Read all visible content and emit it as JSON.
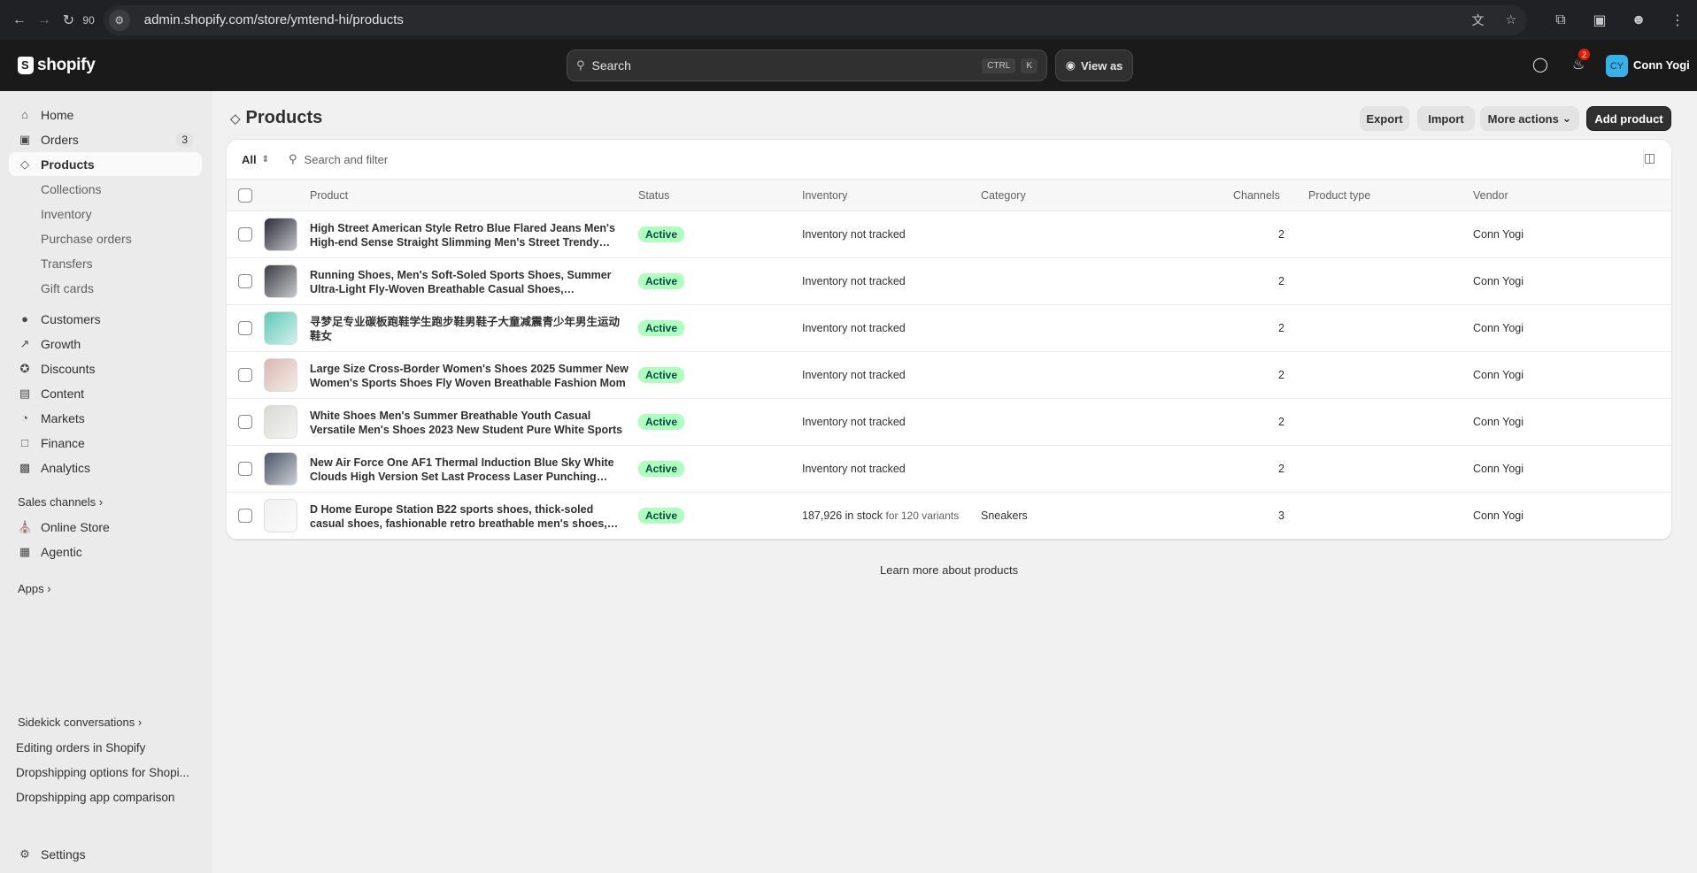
{
  "browser": {
    "zoom": "90",
    "url": "admin.shopify.com/store/ymtend-hi/products"
  },
  "topbar": {
    "logo_text": "shopify",
    "search_placeholder": "Search",
    "shortcut_ctrl": "CTRL",
    "shortcut_k": "K",
    "view_as": "View as",
    "notifications_count": "2",
    "avatar_initials": "CY",
    "user_name": "Conn Yogi"
  },
  "sidebar": {
    "items": [
      {
        "label": "Home",
        "icon": "home-icon"
      },
      {
        "label": "Orders",
        "icon": "orders-icon",
        "count": "3"
      },
      {
        "label": "Products",
        "icon": "tag-icon",
        "active": true
      },
      {
        "label": "Collections",
        "sub": true
      },
      {
        "label": "Inventory",
        "sub": true
      },
      {
        "label": "Purchase orders",
        "sub": true
      },
      {
        "label": "Transfers",
        "sub": true
      },
      {
        "label": "Gift cards",
        "sub": true
      },
      {
        "label": "Customers",
        "icon": "person-icon"
      },
      {
        "label": "Growth",
        "icon": "growth-icon"
      },
      {
        "label": "Discounts",
        "icon": "discount-icon"
      },
      {
        "label": "Content",
        "icon": "content-icon"
      },
      {
        "label": "Markets",
        "icon": "globe-icon"
      },
      {
        "label": "Finance",
        "icon": "bank-icon"
      },
      {
        "label": "Analytics",
        "icon": "chart-icon"
      }
    ],
    "sales_channels_label": "Sales channels",
    "channels": [
      {
        "label": "Online Store",
        "icon": "store-icon"
      },
      {
        "label": "Agentic",
        "icon": "agentic-icon"
      }
    ],
    "apps_label": "Apps",
    "sidekick_label": "Sidekick conversations",
    "sidekick_items": [
      "Editing orders in Shopify",
      "Dropshipping options for Shopi...",
      "Dropshipping app comparison"
    ],
    "settings_label": "Settings"
  },
  "page": {
    "title": "Products",
    "buttons": {
      "export": "Export",
      "import": "Import",
      "more_actions": "More actions",
      "add_product": "Add product"
    },
    "filter_all": "All",
    "filter_search_placeholder": "Search and filter",
    "columns": [
      "Product",
      "Status",
      "Inventory",
      "Category",
      "Channels",
      "Product type",
      "Vendor"
    ],
    "learn_more": "Learn more about products"
  },
  "products": [
    {
      "name": "High Street American Style Retro Blue Flared Jeans Men's High-end Sense Straight Slimming Men's Street Trendy Pants",
      "status": "Active",
      "inventory": "Inventory not tracked",
      "inventory_note": "",
      "category": "",
      "channels": "2",
      "type": "",
      "vendor": "Conn Yogi",
      "thumb_color": "#2b2b3a"
    },
    {
      "name": "Running Shoes, Men's Soft-Soled Sports Shoes, Summer Ultra-Light Fly-Woven Breathable Casual Shoes, Lightweight",
      "status": "Active",
      "inventory": "Inventory not tracked",
      "inventory_note": "",
      "category": "",
      "channels": "2",
      "type": "",
      "vendor": "Conn Yogi",
      "thumb_color": "#3a3d44"
    },
    {
      "name": "寻梦足专业碳板跑鞋学生跑步鞋男鞋子大童减震青少年男生运动鞋女",
      "status": "Active",
      "inventory": "Inventory not tracked",
      "inventory_note": "",
      "category": "",
      "channels": "2",
      "type": "",
      "vendor": "Conn Yogi",
      "thumb_color": "#5fc9b8"
    },
    {
      "name": "Large Size Cross-Border Women's Shoes 2025 Summer New Women's Sports Shoes Fly Woven Breathable Fashion Mom",
      "status": "Active",
      "inventory": "Inventory not tracked",
      "inventory_note": "",
      "category": "",
      "channels": "2",
      "type": "",
      "vendor": "Conn Yogi",
      "thumb_color": "#d9b8b0"
    },
    {
      "name": "White Shoes Men's Summer Breathable Youth Casual Versatile Men's Shoes 2023 New Student Pure White Sports",
      "status": "Active",
      "inventory": "Inventory not tracked",
      "inventory_note": "",
      "category": "",
      "channels": "2",
      "type": "",
      "vendor": "Conn Yogi",
      "thumb_color": "#d8d8d4"
    },
    {
      "name": "New Air Force One AF1 Thermal Induction Blue Sky White Clouds High Version Set Last Process Laser Punching Corre",
      "status": "Active",
      "inventory": "Inventory not tracked",
      "inventory_note": "",
      "category": "",
      "channels": "2",
      "type": "",
      "vendor": "Conn Yogi",
      "thumb_color": "#4a5668"
    },
    {
      "name": "D Home Europe Station B22 sports shoes, thick-soled casual shoes, fashionable retro breathable men's shoes, B25 heigh",
      "status": "Active",
      "inventory": "187,926 in stock",
      "inventory_note": "for 120 variants",
      "category": "Sneakers",
      "channels": "3",
      "type": "",
      "vendor": "Conn Yogi",
      "thumb_color": "#f0f0f0"
    }
  ],
  "colors": {
    "status_active_bg": "#affebf",
    "primary_button": "#303030",
    "avatar": "#37b2e8"
  }
}
